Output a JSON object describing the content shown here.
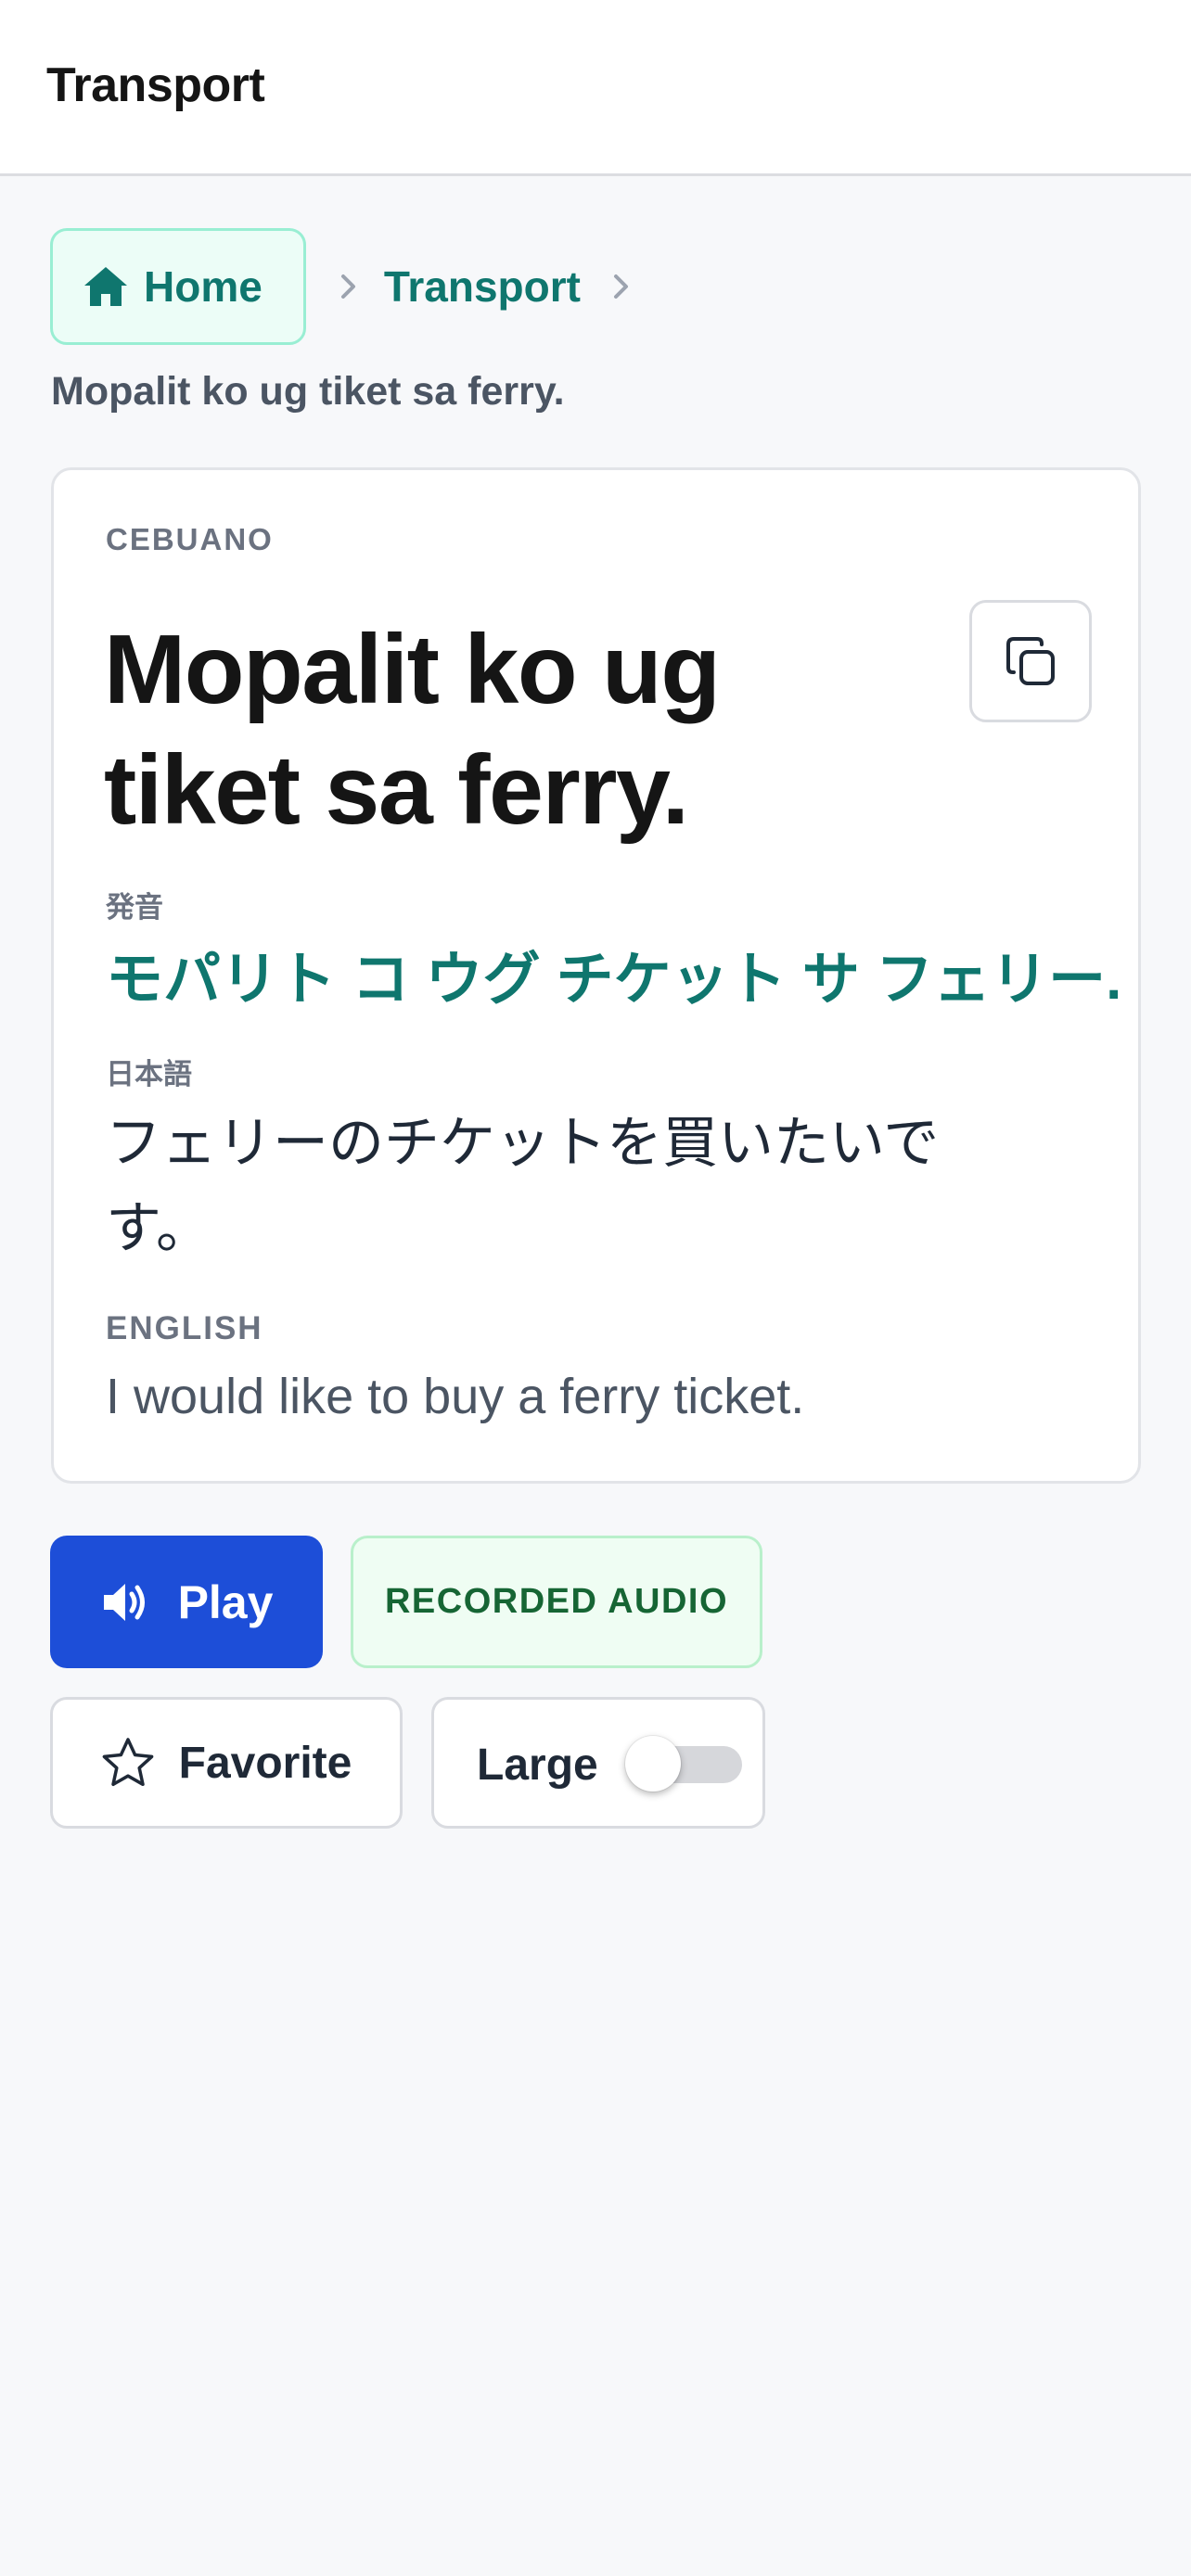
{
  "header": {
    "title": "Transport"
  },
  "breadcrumb": {
    "home_label": "Home",
    "category_label": "Transport"
  },
  "page_subtitle": "Mopalit ko ug tiket sa ferry.",
  "phrase_card": {
    "language_label": "CEBUANO",
    "phrase": "Mopalit ko ug tiket sa ferry.",
    "pronunciation_label": "発音",
    "pronunciation": "モパリト コ ウグ チケット サ フェリー.",
    "japanese_label": "日本語",
    "japanese": "フェリーのチケットを買いたいです。",
    "english_label": "ENGLISH",
    "english": "I would like to buy a ferry ticket."
  },
  "actions": {
    "play_label": "Play",
    "audio_badge": "RECORDED AUDIO",
    "favorite_label": "Favorite",
    "large_label": "Large",
    "large_enabled": false
  },
  "colors": {
    "accent_teal": "#0f766e",
    "play_blue": "#1d4ed8",
    "badge_green": "#166534",
    "background": "#f7f8fa"
  },
  "icons": {
    "home": "home-icon",
    "breadcrumb_separator": "chevron-right-icon",
    "copy": "copy-icon",
    "play": "speaker-icon",
    "favorite": "star-icon"
  }
}
